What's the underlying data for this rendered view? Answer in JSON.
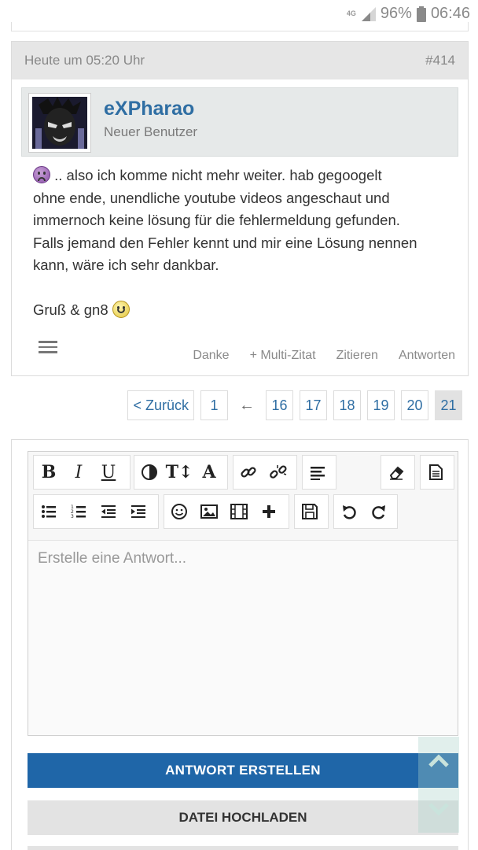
{
  "status_bar": {
    "network": "4G",
    "battery": "96%",
    "time": "06:46"
  },
  "post": {
    "timestamp": "Heute um 05:20 Uhr",
    "number": "#414",
    "author": "eXPharao",
    "author_title": "Neuer Benutzer",
    "body_lines": [
      ".. also ich komme nicht mehr weiter. hab gegoogelt",
      "ohne ende, unendliche youtube videos angeschaut und",
      "immernoch keine lösung für die fehlermeldung gefunden.",
      "Falls jemand den Fehler kennt und mir eine Lösung nennen",
      "kann, wäre ich sehr dankbar."
    ],
    "signoff": "Gruß & gn8",
    "actions": {
      "thanks": "Danke",
      "multiquote": "+ Multi-Zitat",
      "quote": "Zitieren",
      "reply": "Antworten"
    }
  },
  "pagination": {
    "prev_label": "< Zurück",
    "first": "1",
    "ellipsis_arrow": "←",
    "pages": [
      "16",
      "17",
      "18",
      "19",
      "20",
      "21"
    ],
    "current": "21"
  },
  "editor": {
    "placeholder": "Erstelle eine Antwort...",
    "submit_label": "ANTWORT ERSTELLEN",
    "upload_label": "DATEI HOCHLADEN",
    "toolbar_bold": "B",
    "toolbar_italic": "I",
    "toolbar_underline": "U",
    "toolbar_size": "T↕",
    "toolbar_font": "A"
  },
  "colors": {
    "link_blue": "#2f6ea3",
    "primary_button": "#1f66a8",
    "header_gray": "#e6e6e6"
  },
  "icons": [
    "menu-icon",
    "link-icon",
    "unlink-icon",
    "align-icon",
    "eraser-icon",
    "source-icon",
    "bullet-list-icon",
    "numbered-list-icon",
    "outdent-icon",
    "indent-icon",
    "smiley-icon",
    "image-icon",
    "video-icon",
    "plus-icon",
    "save-icon",
    "undo-icon",
    "redo-icon",
    "chevron-up-icon",
    "chevron-down-icon"
  ]
}
